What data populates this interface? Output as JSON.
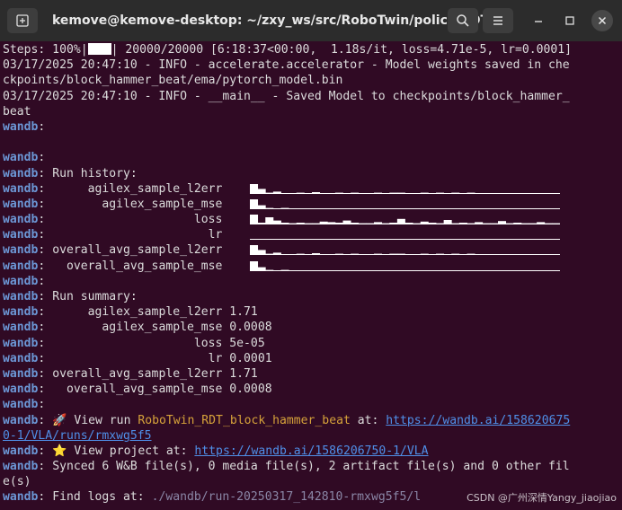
{
  "window": {
    "title": "kemove@kemove-desktop: ~/zxy_ws/src/RoboTwin/policy/RDT",
    "new_tab_icon": "new-tab-icon",
    "search_icon": "search-icon",
    "menu_icon": "hamburger-menu-icon",
    "minimize_icon": "minimize-icon",
    "maximize_icon": "maximize-icon",
    "close_icon": "close-icon"
  },
  "terminal": {
    "steps_prefix": "Steps: 100%|",
    "steps_suffix": "| 20000/20000 [6:18:37<00:00,  1.18s/it, loss=4.71e-5, lr=0.0001]",
    "progress": 1.0,
    "log1_a": "03/17/2025 20:47:10 - INFO - accelerate.accelerator - Model weights saved in che",
    "log1_b": "ckpoints/block_hammer_beat/ema/pytorch_model.bin",
    "log2_a": "03/17/2025 20:47:10 - INFO - __main__ - Saved Model to checkpoints/block_hammer_",
    "log2_b": "beat",
    "wandb_prefix": "wandb",
    "colon": ":",
    "run_history_title": " Run history:",
    "history_metrics": [
      "      agilex_sample_l2err",
      "        agilex_sample_mse",
      "                     loss",
      "                       lr",
      " overall_avg_sample_l2err",
      "   overall_avg_sample_mse"
    ],
    "run_summary_title": " Run summary:",
    "summary_rows": [
      {
        "label": "      agilex_sample_l2err",
        "value": "1.71"
      },
      {
        "label": "        agilex_sample_mse",
        "value": "0.0008"
      },
      {
        "label": "                     loss",
        "value": "5e-05"
      },
      {
        "label": "                       lr",
        "value": "0.0001"
      },
      {
        "label": " overall_avg_sample_l2err",
        "value": "1.71"
      },
      {
        "label": "   overall_avg_sample_mse",
        "value": "0.0008"
      }
    ],
    "view_run_text": " 🚀 View run ",
    "run_name": "RoboTwin_RDT_block_hammer_beat",
    "at_text": " at: ",
    "run_url_a": "https://wandb.ai/158620675",
    "run_url_b": "0-1/VLA/runs/rmxwg5f5",
    "view_project_text": " ⭐ View project at: ",
    "project_url": "https://wandb.ai/1586206750-1/VLA",
    "synced_a": " Synced 6 W&B file(s), 0 media file(s), 2 artifact file(s) and 0 other fil",
    "synced_b": "e(s)",
    "find_logs_text": " Find logs at: ",
    "logs_path": "./wandb/run-20250317_142810-rmxwg5f5/l"
  },
  "watermark": "CSDN @广州深情Yangy_jiaojiao",
  "colors": {
    "terminal_bg": "#300a24",
    "wandb_blue": "#6c97d6",
    "brand_yellow": "#d6a23a",
    "link_blue": "#4f8fe8"
  },
  "sparklines": [
    [
      1.0,
      0.55,
      0.2,
      0.3,
      0.15,
      0.15,
      0.2,
      0.15,
      0.25,
      0.15,
      0.15,
      0.2,
      0.15,
      0.2,
      0.15,
      0.15,
      0.2,
      0.15,
      0.2,
      0.2,
      0.15,
      0.15,
      0.2,
      0.15,
      0.2,
      0.15,
      0.2,
      0.15,
      0.2,
      0.15,
      0.15,
      0.15,
      0.15,
      0.15,
      0.15,
      0.15,
      0.15,
      0.15,
      0.15,
      0.15
    ],
    [
      1.0,
      0.45,
      0.2,
      0.15,
      0.2,
      0.15,
      0.15,
      0.15,
      0.15,
      0.15,
      0.15,
      0.15,
      0.15,
      0.15,
      0.15,
      0.15,
      0.15,
      0.15,
      0.15,
      0.15,
      0.15,
      0.15,
      0.15,
      0.15,
      0.15,
      0.15,
      0.15,
      0.15,
      0.15,
      0.15,
      0.15,
      0.15,
      0.15,
      0.15,
      0.15,
      0.15,
      0.15,
      0.15,
      0.15,
      0.15
    ],
    [
      1.0,
      0.25,
      0.75,
      0.45,
      0.25,
      0.2,
      0.25,
      0.2,
      0.2,
      0.35,
      0.3,
      0.25,
      0.45,
      0.25,
      0.2,
      0.2,
      0.3,
      0.2,
      0.25,
      0.6,
      0.25,
      0.2,
      0.35,
      0.25,
      0.2,
      0.5,
      0.2,
      0.25,
      0.2,
      0.3,
      0.2,
      0.2,
      0.4,
      0.2,
      0.25,
      0.2,
      0.2,
      0.3,
      0.2,
      0.2
    ],
    [
      0.15,
      0.15,
      0.15,
      0.15,
      0.15,
      0.15,
      0.15,
      0.15,
      0.15,
      0.15,
      0.15,
      0.15,
      0.15,
      0.15,
      0.15,
      0.15,
      0.15,
      0.15,
      0.15,
      0.15,
      0.15,
      0.15,
      0.15,
      0.15,
      0.15,
      0.15,
      0.15,
      0.15,
      0.15,
      0.15,
      0.15,
      0.15,
      0.15,
      0.15,
      0.15,
      0.15,
      0.15,
      0.15,
      0.15,
      0.15
    ],
    [
      1.0,
      0.55,
      0.2,
      0.3,
      0.15,
      0.15,
      0.2,
      0.15,
      0.25,
      0.15,
      0.15,
      0.2,
      0.15,
      0.2,
      0.15,
      0.15,
      0.2,
      0.15,
      0.2,
      0.2,
      0.15,
      0.15,
      0.2,
      0.15,
      0.2,
      0.15,
      0.2,
      0.15,
      0.2,
      0.15,
      0.15,
      0.15,
      0.15,
      0.15,
      0.15,
      0.15,
      0.15,
      0.15,
      0.15,
      0.15
    ],
    [
      1.0,
      0.45,
      0.2,
      0.15,
      0.2,
      0.15,
      0.15,
      0.15,
      0.15,
      0.15,
      0.15,
      0.15,
      0.15,
      0.15,
      0.15,
      0.15,
      0.15,
      0.15,
      0.15,
      0.15,
      0.15,
      0.15,
      0.15,
      0.15,
      0.15,
      0.15,
      0.15,
      0.15,
      0.15,
      0.15,
      0.15,
      0.15,
      0.15,
      0.15,
      0.15,
      0.15,
      0.15,
      0.15,
      0.15,
      0.15
    ]
  ]
}
